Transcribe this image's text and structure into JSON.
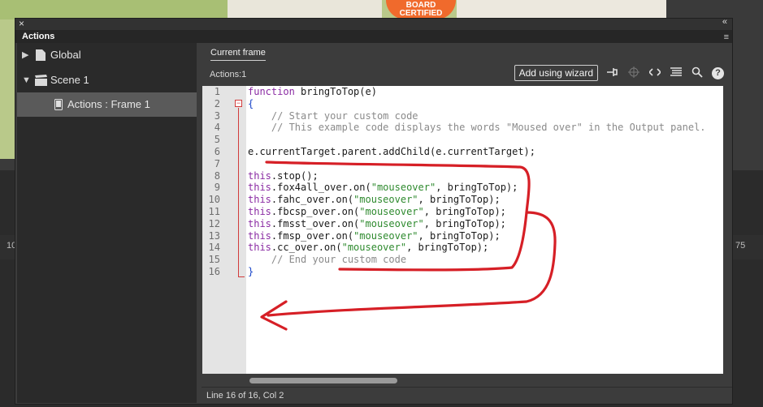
{
  "background": {
    "stage_badge": "BOARD CERTIFIED",
    "ruler_left": "10",
    "ruler_right": "75"
  },
  "panel": {
    "title": "Actions",
    "close_glyph": "×",
    "collapse_glyph": "«",
    "menu_glyph": "≡"
  },
  "sidebar": {
    "items": [
      {
        "label": "Global",
        "icon": "file-icon",
        "expanded": false
      },
      {
        "label": "Scene 1",
        "icon": "clapperboard-icon",
        "expanded": true
      },
      {
        "label": "Actions : Frame 1",
        "icon": "mobile-doc-icon",
        "selected": true
      }
    ]
  },
  "main": {
    "tab_label": "Current frame",
    "breadcrumb": "Actions:1",
    "toolbar": {
      "wizard_label": "Add using wizard",
      "icons": [
        "pin-icon",
        "target-icon",
        "code-brackets-icon",
        "format-icon",
        "search-icon",
        "help-icon"
      ]
    }
  },
  "editor": {
    "line_numbers": [
      "1",
      "2",
      "3",
      "4",
      "5",
      "6",
      "7",
      "8",
      "9",
      "10",
      "11",
      "12",
      "13",
      "14",
      "15",
      "16"
    ],
    "lines": [
      [
        {
          "t": "function",
          "c": "kw"
        },
        {
          "t": " bringToTop(e)",
          "c": ""
        }
      ],
      [
        {
          "t": "{",
          "c": "br"
        }
      ],
      [
        {
          "t": "    // Start your custom code",
          "c": "cm"
        }
      ],
      [
        {
          "t": "    // This example code displays the words \"Moused over\" in the Output panel.",
          "c": "cm"
        }
      ],
      [
        {
          "t": "",
          "c": ""
        }
      ],
      [
        {
          "t": "e.currentTarget.parent.addChild(e.currentTarget);",
          "c": ""
        }
      ],
      [
        {
          "t": "",
          "c": ""
        }
      ],
      [
        {
          "t": "this",
          "c": "kw"
        },
        {
          "t": ".stop();",
          "c": ""
        }
      ],
      [
        {
          "t": "this",
          "c": "kw"
        },
        {
          "t": ".fox4all_over.on(",
          "c": ""
        },
        {
          "t": "\"mouseover\"",
          "c": "str"
        },
        {
          "t": ", bringToTop);",
          "c": ""
        }
      ],
      [
        {
          "t": "this",
          "c": "kw"
        },
        {
          "t": ".fahc_over.on(",
          "c": ""
        },
        {
          "t": "\"mouseover\"",
          "c": "str"
        },
        {
          "t": ", bringToTop);",
          "c": ""
        }
      ],
      [
        {
          "t": "this",
          "c": "kw"
        },
        {
          "t": ".fbcsp_over.on(",
          "c": ""
        },
        {
          "t": "\"mouseover\"",
          "c": "str"
        },
        {
          "t": ", bringToTop);",
          "c": ""
        }
      ],
      [
        {
          "t": "this",
          "c": "kw"
        },
        {
          "t": ".fmsst_over.on(",
          "c": ""
        },
        {
          "t": "\"mouseover\"",
          "c": "str"
        },
        {
          "t": ", bringToTop);",
          "c": ""
        }
      ],
      [
        {
          "t": "this",
          "c": "kw"
        },
        {
          "t": ".fmsp_over.on(",
          "c": ""
        },
        {
          "t": "\"mouseover\"",
          "c": "str"
        },
        {
          "t": ", bringToTop);",
          "c": ""
        }
      ],
      [
        {
          "t": "this",
          "c": "kw"
        },
        {
          "t": ".cc_over.on(",
          "c": ""
        },
        {
          "t": "\"mouseover\"",
          "c": "str"
        },
        {
          "t": ", bringToTop);",
          "c": ""
        }
      ],
      [
        {
          "t": "    // End your custom code",
          "c": "cm"
        }
      ],
      [
        {
          "t": "}",
          "c": "br"
        }
      ]
    ]
  },
  "status": {
    "text": "Line 16 of 16, Col 2"
  },
  "colors": {
    "annotation_red": "#d61f26",
    "keyword": "#8a2ba3",
    "string": "#2e8a2e",
    "comment": "#8a8a8a"
  }
}
